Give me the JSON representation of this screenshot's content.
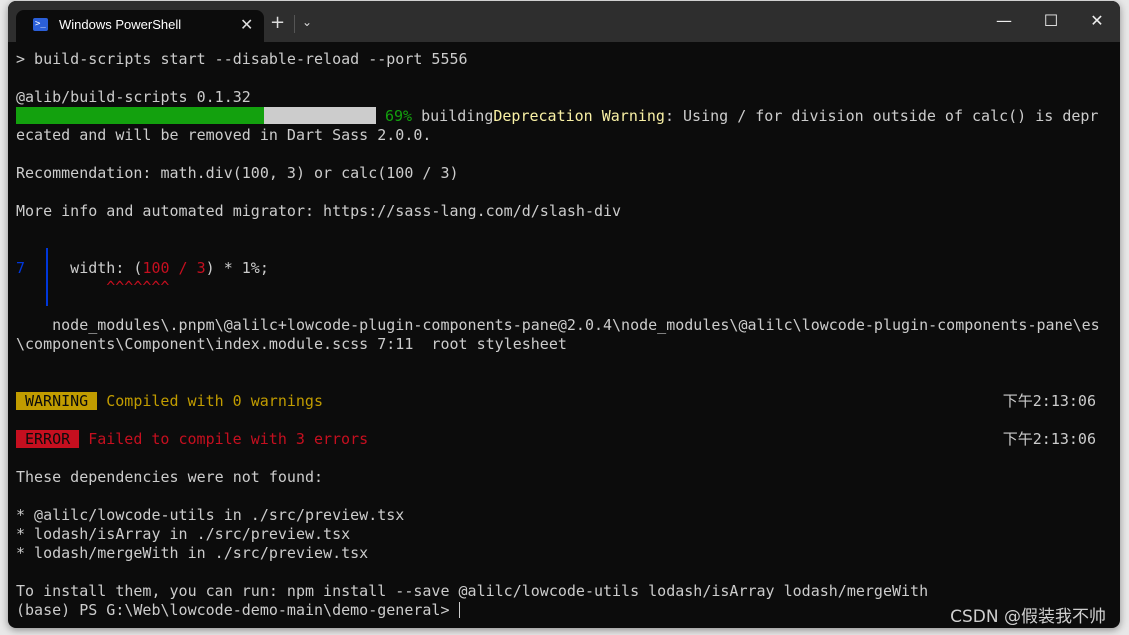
{
  "window": {
    "tab_title": "Windows PowerShell",
    "tab_icon": "powershell-icon",
    "new_tab": "+",
    "dropdown": "⌄",
    "minimize": "—",
    "maximize": "☐",
    "close": "✕"
  },
  "colors": {
    "background": "#0c0c0c",
    "text": "#cccccc",
    "green": "#13a10e",
    "yellow": "#c19c00",
    "red": "#c50f1f",
    "blue": "#0037da"
  },
  "terminal": {
    "command": "> build-scripts start --disable-reload --port 5556",
    "version": "@alib/build-scripts 0.1.32",
    "progress": {
      "percent": 69,
      "percent_label": "69%",
      "status": "building"
    },
    "deprecation_title": "Deprecation Warning",
    "deprecation_text": ": Using / for division outside of calc() is depr",
    "deprecation_text2": "ecated and will be removed in Dart Sass 2.0.0.",
    "recommendation": "Recommendation: math.div(100, 3) or calc(100 / 3)",
    "more_info": "More info and automated migrator: https://sass-lang.com/d/slash-div",
    "code_line_number": "7",
    "code_pre": "   width: (",
    "code_hl": "100 / 3",
    "code_post": ") * 1%;",
    "code_caret": "        ^^^^^^^",
    "path1": "    node_modules\\.pnpm\\@alilc+lowcode-plugin-components-pane@2.0.4\\node_modules\\@alilc\\lowcode-plugin-components-pane\\es",
    "path2": "\\components\\Component\\index.module.scss 7:11  root stylesheet",
    "warning_badge": "WARNING",
    "warning_text": "Compiled with 0 warnings",
    "warning_time": "下午2:13:06",
    "error_badge": "ERROR",
    "error_text": "Failed to compile with 3 errors",
    "error_time": "下午2:13:06",
    "deps_header": "These dependencies were not found:",
    "deps": [
      "* @alilc/lowcode-utils in ./src/preview.tsx",
      "* lodash/isArray in ./src/preview.tsx",
      "* lodash/mergeWith in ./src/preview.tsx"
    ],
    "install_hint": "To install them, you can run: npm install --save @alilc/lowcode-utils lodash/isArray lodash/mergeWith",
    "prompt": "(base) PS G:\\Web\\lowcode-demo-main\\demo-general> "
  },
  "watermark": "CSDN @假装我不帅"
}
